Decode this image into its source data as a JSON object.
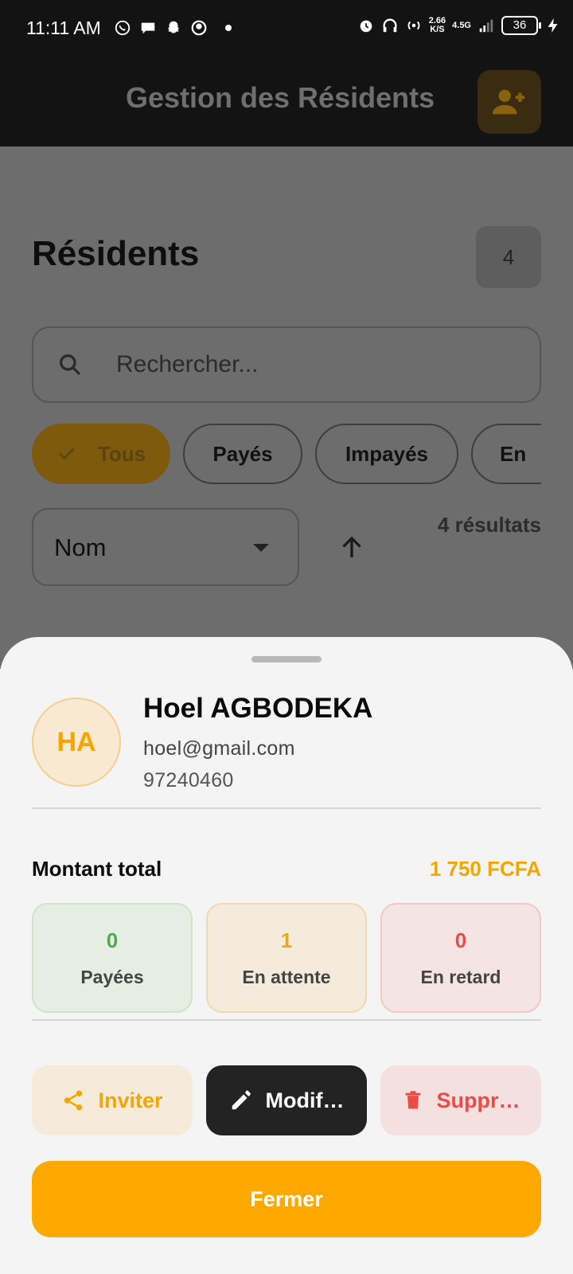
{
  "status_bar": {
    "time": "11:11 AM",
    "speed_value": "2.66",
    "speed_unit": "K/S",
    "network": "4.5G",
    "battery": "36"
  },
  "app_bar": {
    "title": "Gestion des Résidents"
  },
  "page": {
    "title": "Résidents",
    "count": "4",
    "search_placeholder": "Rechercher...",
    "filters": [
      {
        "label": "Tous",
        "active": true
      },
      {
        "label": "Payés",
        "active": false
      },
      {
        "label": "Impayés",
        "active": false
      },
      {
        "label": "En",
        "active": false
      }
    ],
    "sort_field": "Nom",
    "results_text": "4 résultats"
  },
  "sheet": {
    "initials": "HA",
    "name": "Hoel AGBODEKA",
    "email": "hoel@gmail.com",
    "phone": "97240460",
    "total_label": "Montant total",
    "total_value": "1 750 FCFA",
    "stats": [
      {
        "value": "0",
        "label": "Payées"
      },
      {
        "value": "1",
        "label": "En attente"
      },
      {
        "value": "0",
        "label": "En retard"
      }
    ],
    "actions": {
      "invite": "Inviter",
      "edit": "Modif…",
      "delete": "Suppr…"
    },
    "close_label": "Fermer"
  },
  "colors": {
    "accent": "#ffa800",
    "paid": "#4aab4f",
    "late": "#ea4b47"
  }
}
